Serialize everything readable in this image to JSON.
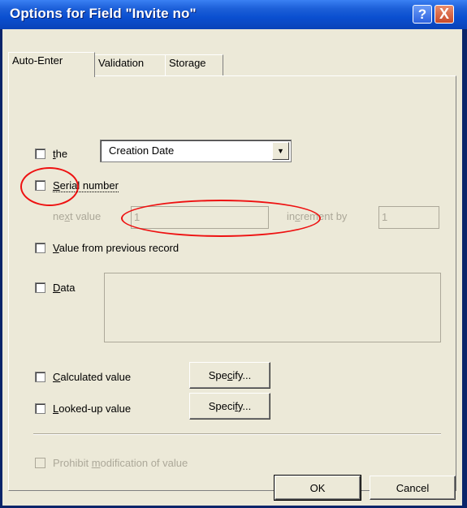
{
  "window": {
    "title": "Options for Field \"Invite no\"",
    "help_glyph": "?",
    "close_glyph": "X"
  },
  "tabs": [
    {
      "label": "Auto-Enter",
      "active": true
    },
    {
      "label": "Validation"
    },
    {
      "label": "Storage"
    }
  ],
  "auto_enter": {
    "the_label": "the",
    "the_select_value": "Creation Date",
    "serial_label": "Serial number",
    "next_value_label": "next value",
    "next_value": "1",
    "increment_label": "increment by",
    "increment_value": "1",
    "prev_record_label": "Value from previous record",
    "data_label": "Data",
    "calc_label": "Calculated value",
    "calc_specify": "Specify...",
    "lookup_label": "Looked-up value",
    "lookup_specify": "Specify...",
    "prohibit_label": "Prohibit modification of value"
  },
  "footer": {
    "ok": "OK",
    "cancel": "Cancel"
  },
  "annotation_color": "#e11111"
}
